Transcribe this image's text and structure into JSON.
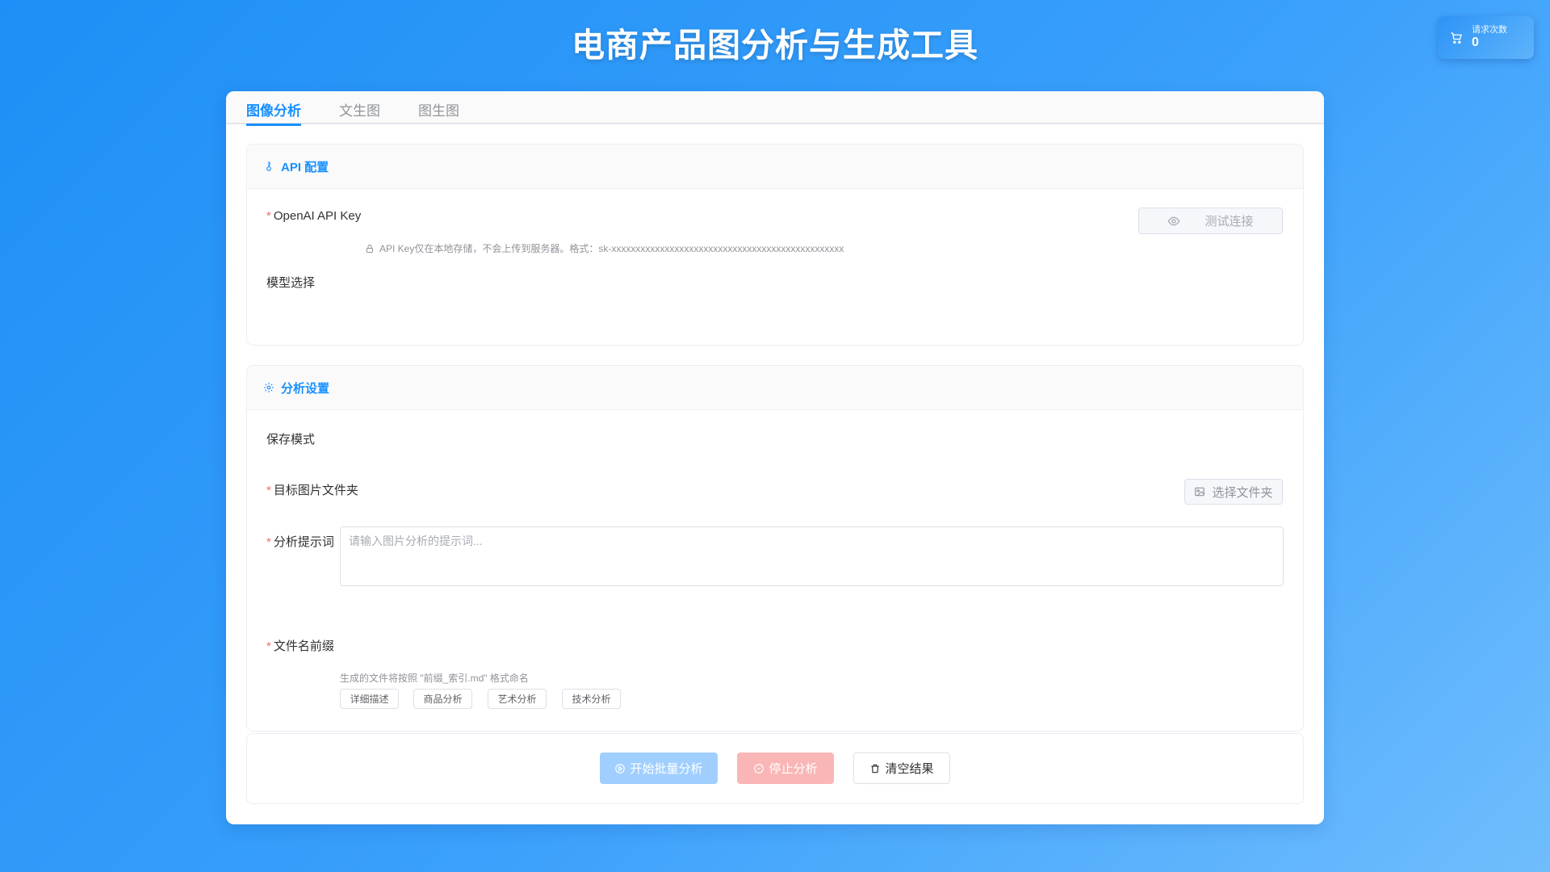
{
  "app": {
    "title": "电商产品图分析与生成工具"
  },
  "counter": {
    "label": "请求次数",
    "value": "0",
    "icon": "cart-icon"
  },
  "tabs": [
    {
      "label": "图像分析",
      "active": true
    },
    {
      "label": "文生图",
      "active": false
    },
    {
      "label": "图生图",
      "active": false
    }
  ],
  "api_section": {
    "title": "API 配置",
    "icon": "key-icon",
    "api_key_label": "OpenAI API Key",
    "test_button": "测试连接",
    "hint": "API Key仅在本地存储，不会上传到服务器。格式：sk-xxxxxxxxxxxxxxxxxxxxxxxxxxxxxxxxxxxxxxxxxxxxxxxx",
    "model_label": "模型选择"
  },
  "analysis_section": {
    "title": "分析设置",
    "icon": "gear-icon",
    "save_mode_label": "保存模式",
    "folder_label": "目标图片文件夹",
    "folder_button": "选择文件夹",
    "prompt_label": "分析提示词",
    "prompt_placeholder": "请输入图片分析的提示词...",
    "prompt_tags": [
      "详细描述",
      "商品分析",
      "艺术分析",
      "技术分析"
    ],
    "prefix_label": "文件名前缀",
    "prefix_hint": "生成的文件将按照 \"前缀_索引.md\" 格式命名"
  },
  "actions": {
    "start": "开始批量分析",
    "stop": "停止分析",
    "clear": "清空结果"
  },
  "colors": {
    "primary": "#1890ff",
    "danger": "#f56c6c",
    "start_disabled": "#a0cfff",
    "stop_disabled": "#fab6b6"
  }
}
